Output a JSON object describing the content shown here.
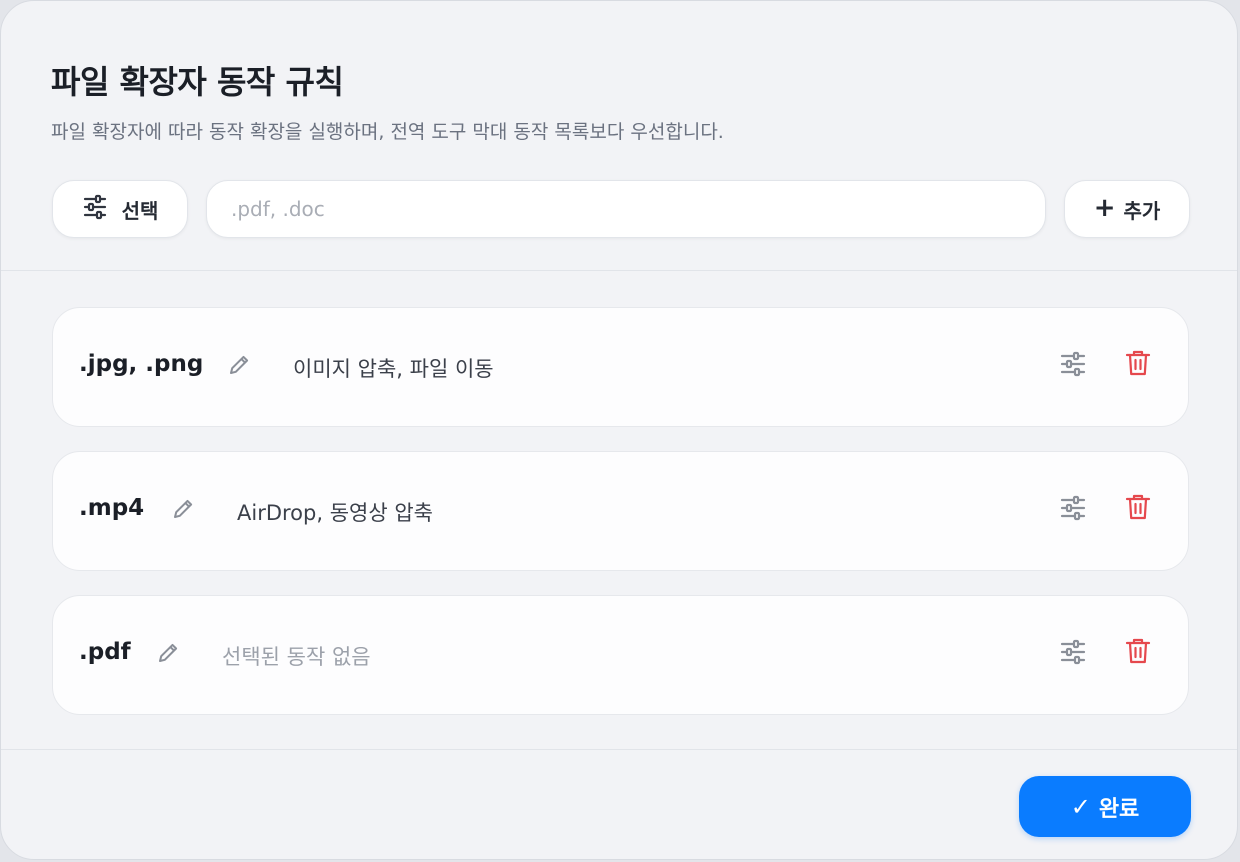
{
  "dialog": {
    "title": "파일 확장자 동작 규칙",
    "subtitle": "파일 확장자에 따라 동작 확장을 실행하며, 전역 도구 막대 동작 목록보다 우선합니다."
  },
  "toolbar": {
    "select_label": "선택",
    "select_icon": "sliders-icon",
    "input_value": "",
    "input_placeholder": ".pdf, .doc",
    "add_label": "추가",
    "add_icon": "plus-icon"
  },
  "rules": [
    {
      "extensions": ".jpg, .png",
      "actions": "이미지 압축, 파일 이동"
    },
    {
      "extensions": ".mp4",
      "actions": "AirDrop, 동영상 압축"
    },
    {
      "extensions": ".pdf",
      "actions": "선택된 동작 없음"
    }
  ],
  "footer": {
    "done_label": "완료",
    "done_icon": "checkmark-icon"
  },
  "colors": {
    "accent": "#0a7cff",
    "delete": "#e5484d",
    "icon_muted": "#8a8f98"
  }
}
